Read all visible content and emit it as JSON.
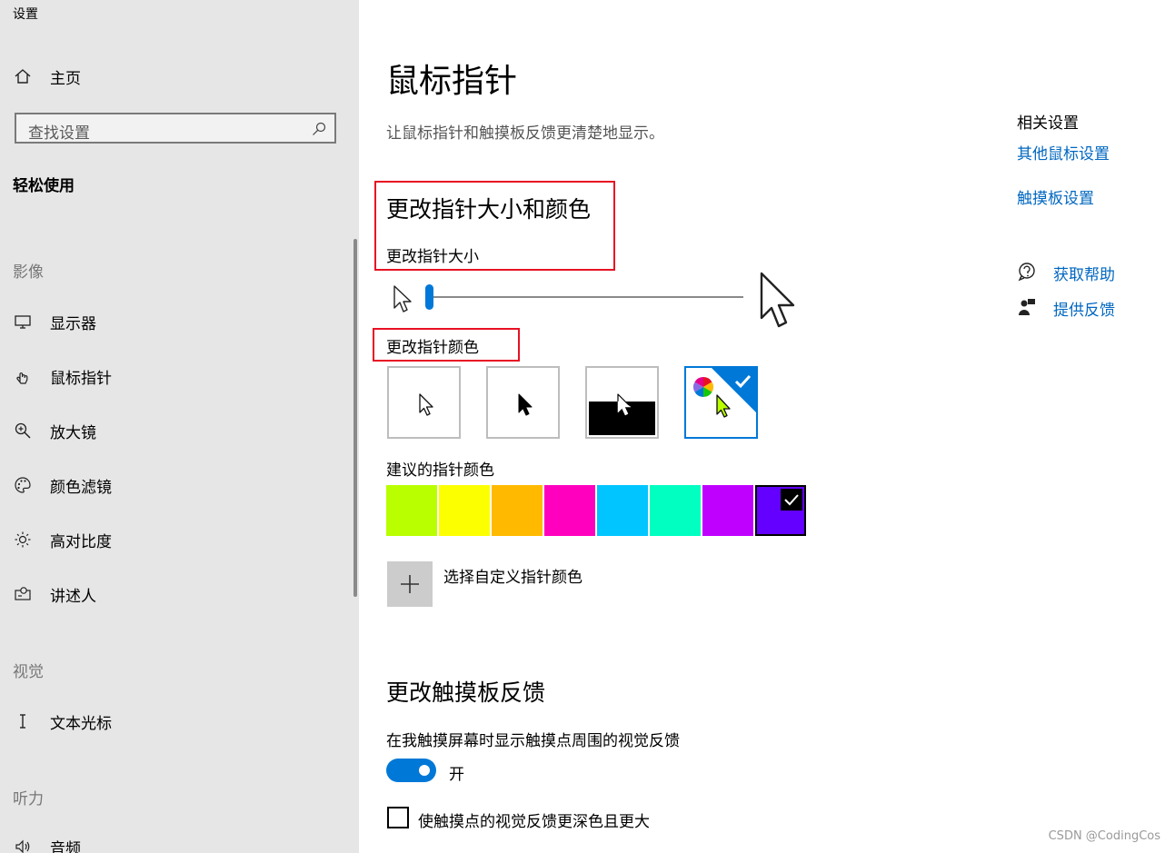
{
  "window": {
    "title": "设置"
  },
  "sidebar": {
    "home_label": "主页",
    "search_placeholder": "查找设置",
    "category_title": "轻松使用",
    "groups": [
      {
        "heading": "影像",
        "items": [
          {
            "label": "显示器",
            "icon": "monitor-icon"
          },
          {
            "label": "鼠标指针",
            "icon": "mouse-pointer-icon"
          },
          {
            "label": "放大镜",
            "icon": "magnifier-icon"
          },
          {
            "label": "颜色滤镜",
            "icon": "palette-icon"
          },
          {
            "label": "高对比度",
            "icon": "sun-icon"
          },
          {
            "label": "讲述人",
            "icon": "narrator-icon"
          }
        ]
      },
      {
        "heading": "视觉",
        "items": [
          {
            "label": "文本光标",
            "icon": "text-cursor-icon"
          }
        ]
      },
      {
        "heading": "听力",
        "items": [
          {
            "label": "音频",
            "icon": "speaker-icon"
          }
        ]
      }
    ]
  },
  "main": {
    "title": "鼠标指针",
    "description": "让鼠标指针和触摸板反馈更清楚地显示。",
    "size_color_section": {
      "heading": "更改指针大小和颜色",
      "size_label": "更改指针大小",
      "size_level": 1,
      "color_label": "更改指针颜色",
      "pointer_color_options": [
        {
          "name": "white",
          "selected": false
        },
        {
          "name": "black",
          "selected": false
        },
        {
          "name": "inverted",
          "selected": false
        },
        {
          "name": "custom",
          "selected": true
        }
      ],
      "suggested_label": "建议的指针颜色",
      "suggested_colors": [
        {
          "color": "#b9ff00",
          "selected": false
        },
        {
          "color": "#fbff00",
          "selected": false
        },
        {
          "color": "#ffba00",
          "selected": false
        },
        {
          "color": "#ff00bf",
          "selected": false
        },
        {
          "color": "#00c5ff",
          "selected": false
        },
        {
          "color": "#00ffc0",
          "selected": false
        },
        {
          "color": "#bf00ff",
          "selected": false
        },
        {
          "color": "#6300ff",
          "selected": true
        }
      ],
      "custom_color_label": "选择自定义指针颜色"
    },
    "touch_section": {
      "heading": "更改触摸板反馈",
      "visual_feedback_label": "在我触摸屏幕时显示触摸点周围的视觉反馈",
      "toggle_state": "开",
      "toggle_on": true,
      "darker_label": "使触摸点的视觉反馈更深色且更大",
      "darker_checked": false
    }
  },
  "related": {
    "heading": "相关设置",
    "links": [
      "其他鼠标设置",
      "触摸板设置"
    ],
    "help_label": "获取帮助",
    "feedback_label": "提供反馈"
  },
  "watermark": "CSDN @CodingCos",
  "colors": {
    "accent": "#0078d7",
    "link": "#0067c0",
    "highlight_box": "#e81123"
  }
}
